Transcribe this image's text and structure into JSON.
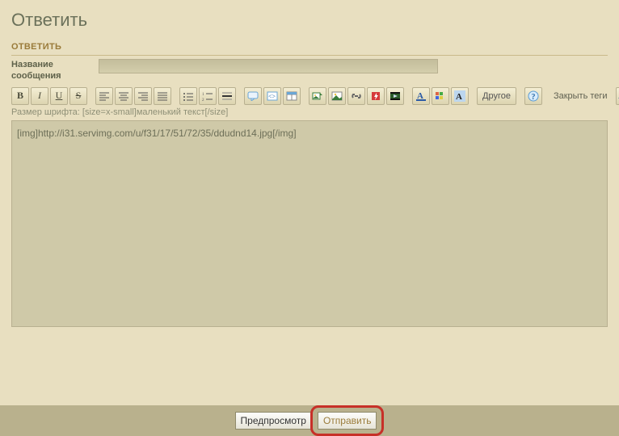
{
  "page": {
    "title": "Ответить"
  },
  "form": {
    "section_header": "ОТВЕТИТЬ",
    "title_label": "Название сообщения",
    "title_value": ""
  },
  "toolbar": {
    "bold": "B",
    "italic": "I",
    "underline": "U",
    "strike": "S",
    "other_label": "Другое",
    "close_tags": "Закрыть теги"
  },
  "hint": "Размер шрифта: [size=x-small]маленький текст[/size]",
  "editor": {
    "content": "[img]http://i31.servimg.com/u/f31/17/51/72/35/ddudnd14.jpg[/img]"
  },
  "buttons": {
    "preview": "Предпросмотр",
    "submit": "Отправить"
  }
}
